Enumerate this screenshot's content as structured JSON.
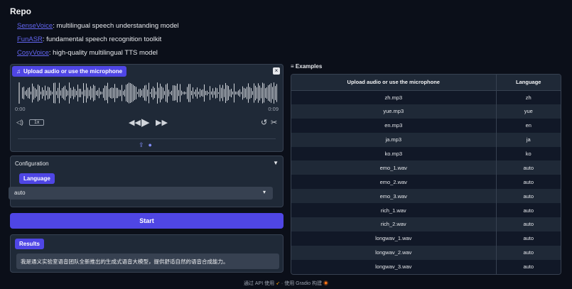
{
  "repo": {
    "title": "Repo",
    "links": [
      {
        "name": "SenseVoice",
        "desc": ": multilingual speech understanding model"
      },
      {
        "name": "FunASR",
        "desc": ": fundamental speech recognition toolkit"
      },
      {
        "name": "CosyVoice",
        "desc": ": high-quality multilingual TTS model"
      }
    ]
  },
  "audio": {
    "label": "Upload audio or use the microphone",
    "label_icon": "music-note-icon",
    "time_start": "0:00",
    "time_end": "0:09",
    "speed": "1x",
    "icons": [
      "volume-icon",
      "rewind-icon",
      "play-icon",
      "fast-forward-icon",
      "undo-icon",
      "scissors-icon",
      "upload-icon",
      "microphone-icon"
    ]
  },
  "config": {
    "title": "Configuration",
    "language_label": "Language",
    "language_value": "auto"
  },
  "start_label": "Start",
  "results": {
    "label": "Results",
    "text": "我是通义实验室语音团队全新推出的生成式语音大模型，提供舒适自然的语音合成能力。"
  },
  "examples": {
    "label": "Examples",
    "headers": [
      "Upload audio or use the microphone",
      "Language"
    ],
    "rows": [
      [
        "zh.mp3",
        "zh"
      ],
      [
        "yue.mp3",
        "yue"
      ],
      [
        "en.mp3",
        "en"
      ],
      [
        "ja.mp3",
        "ja"
      ],
      [
        "ko.mp3",
        "ko"
      ],
      [
        "emo_1.wav",
        "auto"
      ],
      [
        "emo_2.wav",
        "auto"
      ],
      [
        "emo_3.wav",
        "auto"
      ],
      [
        "rich_1.wav",
        "auto"
      ],
      [
        "rich_2.wav",
        "auto"
      ],
      [
        "longwav_1.wav",
        "auto"
      ],
      [
        "longwav_2.wav",
        "auto"
      ],
      [
        "longwav_3.wav",
        "auto"
      ]
    ]
  },
  "footer": {
    "api": "通过 API 使用",
    "sep": "·",
    "built": "使用 Gradio 构建"
  },
  "colors": {
    "accent": "#4f46e5",
    "background": "#0b0f19",
    "panel": "#1f2937"
  }
}
